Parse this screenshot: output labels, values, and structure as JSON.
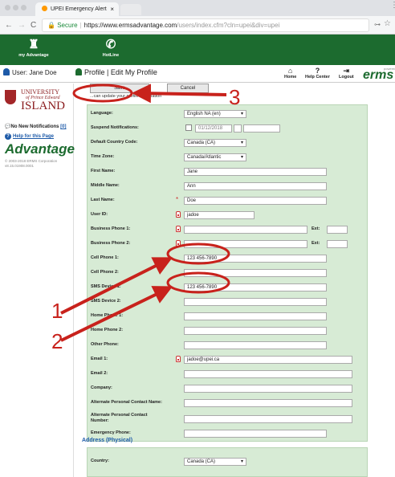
{
  "browser": {
    "tab_title": "UPEI Emergency Alert",
    "tab_close": "×",
    "nav_back": "←",
    "nav_forward": "→",
    "nav_reload": "C",
    "secure_label": "Secure",
    "url_domain": "https://www.ermsadvantage.com",
    "url_path": "/users/index.cfm?cln=upei&div=upei",
    "key_glyph": "⊶",
    "star_glyph": "☆",
    "menu_glyph": "⋮"
  },
  "appbar": {
    "my_advantage_label": "my Advantage",
    "my_advantage_icon": "♜",
    "hotline_label": "HotLine",
    "hotline_icon": "✆"
  },
  "subbar": {
    "user_label": "User: Jane Doe",
    "page_title": "Profile | Edit My Profile",
    "home_label": "Home",
    "home_icon": "⌂",
    "help_label": "Help Center",
    "help_icon": "?",
    "logout_label": "Logout",
    "logout_icon": "⇥",
    "brand": "erms",
    "brand_suffix": "powered"
  },
  "sidebar": {
    "uni_line1": "UNIVERSITY",
    "uni_line2": "of Prince Edward",
    "uni_line3": "ISLAND",
    "notif_text": "No New Notifications",
    "notif_count": "[0]",
    "help_text": "Help for this Page",
    "help_q": "?",
    "advantage": "Advantage",
    "copyright_1": "© 2003-2018 ERMS Corporation",
    "copyright_2": "v8.15.01908.0001"
  },
  "actions": {
    "save_label": "Save",
    "cancel_label": "Cancel",
    "hint_text": "...can update your profile information"
  },
  "form": {
    "language_label": "Language:",
    "language_value": "English NA (en)",
    "suspend_label": "Suspend Notifications:",
    "suspend_date": "01/12/2018",
    "country_code_label": "Default Country Code:",
    "country_code_value": "Canada (CA)",
    "timezone_label": "Time Zone:",
    "timezone_value": "Canada/Atlantic",
    "first_name_label": "First Name:",
    "first_name_value": "Jane",
    "middle_name_label": "Middle Name:",
    "middle_name_value": "Ann",
    "last_name_label": "Last Name:",
    "last_name_value": "Doe",
    "user_id_label": "User ID:",
    "user_id_value": "jadoe",
    "business1_label": "Business Phone 1:",
    "business2_label": "Business Phone 2:",
    "ext_label": "Ext:",
    "cell1_label": "Cell Phone 1:",
    "cell1_value": "123 456-7890",
    "cell2_label": "Cell Phone 2:",
    "sms1_label": "SMS Device 1:",
    "sms1_value": "123 456-7890",
    "sms2_label": "SMS Device 2:",
    "home1_label": "Home Phone 1:",
    "home2_label": "Home Phone 2:",
    "other_label": "Other Phone:",
    "email1_label": "Email 1:",
    "email1_value": "jadoe@upei.ca",
    "email2_label": "Email 2:",
    "company_label": "Company:",
    "alt_name_label": "Alternate Personal Contact Name:",
    "alt_number_label_1": "Alternate Personal Contact",
    "alt_number_label_2": "Number:",
    "emergency_label": "Emergency Phone:"
  },
  "address": {
    "heading": "Address (Physical)",
    "country_label": "Country:",
    "country_value": "Canada (CA)"
  },
  "annotations": {
    "callout_1": "1",
    "callout_2": "2",
    "callout_3": "3",
    "color": "#c8221c"
  }
}
